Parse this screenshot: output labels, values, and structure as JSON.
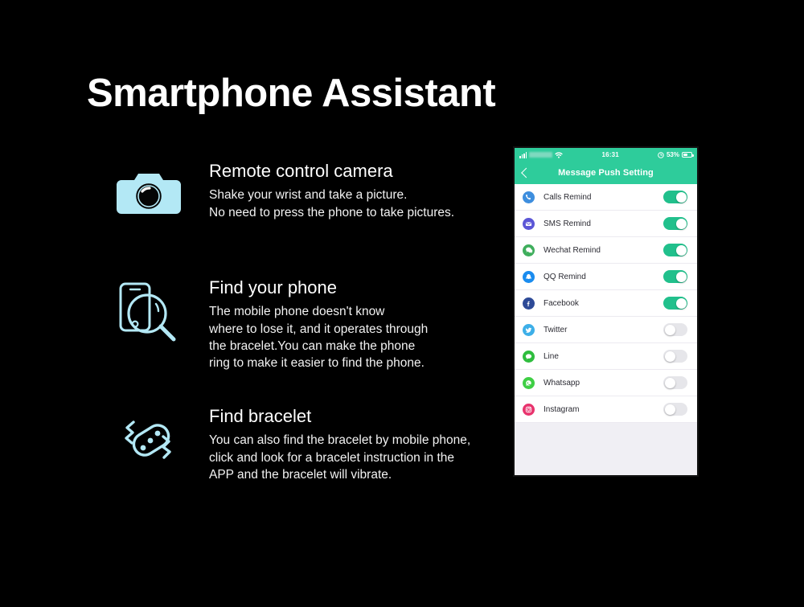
{
  "slide": {
    "title": "Smartphone Assistant",
    "background_color": "#000000",
    "icon_color": "#b3e8f5",
    "accent_green": "#2ecc9b"
  },
  "features": [
    {
      "icon": "camera-icon",
      "heading": "Remote control camera",
      "body": "Shake your wrist and take a picture.\nNo need to press the phone to take pictures."
    },
    {
      "icon": "find-phone-icon",
      "heading": "Find your phone",
      "body": "The mobile phone doesn't know\nwhere to lose it, and it operates through\nthe bracelet.You can make the phone\nring to make it easier to find the phone."
    },
    {
      "icon": "find-bracelet-icon",
      "heading": "Find bracelet",
      "body": "You can also find the bracelet by mobile phone,\n click and  look for a bracelet instruction in the\nAPP and the bracelet will vibrate."
    }
  ],
  "phone": {
    "statusbar": {
      "signal_icon": "signal-bars-icon",
      "carrier": "",
      "wifi_icon": "wifi-icon",
      "time": "16:31",
      "alarm_icon": "alarm-icon",
      "battery_percent": "53%",
      "battery_icon": "battery-icon"
    },
    "navbar": {
      "back_icon": "chevron-left-icon",
      "title": "Message Push Setting"
    },
    "rows": [
      {
        "icon": "phone-call-icon",
        "icon_color": "#3e8ede",
        "label": "Calls Remind",
        "enabled": true
      },
      {
        "icon": "envelope-icon",
        "icon_color": "#5b56d6",
        "label": "SMS Remind",
        "enabled": true
      },
      {
        "icon": "wechat-icon",
        "icon_color": "#3fae5c",
        "label": "Wechat Remind",
        "enabled": true
      },
      {
        "icon": "qq-penguin-icon",
        "icon_color": "#1a8cef",
        "label": "QQ Remind",
        "enabled": true
      },
      {
        "icon": "facebook-icon",
        "icon_color": "#2d4a97",
        "label": "Facebook",
        "enabled": true
      },
      {
        "icon": "twitter-icon",
        "icon_color": "#3dafe8",
        "label": "Twitter",
        "enabled": false
      },
      {
        "icon": "line-icon",
        "icon_color": "#2fbd3e",
        "label": "Line",
        "enabled": false
      },
      {
        "icon": "whatsapp-icon",
        "icon_color": "#3fcf45",
        "label": "Whatsapp",
        "enabled": false
      },
      {
        "icon": "instagram-icon",
        "icon_color": "#e8336d",
        "label": "Instagram",
        "enabled": false
      }
    ],
    "toggle_on_color": "#21c08c",
    "toggle_off_color": "#e6e6ea"
  }
}
